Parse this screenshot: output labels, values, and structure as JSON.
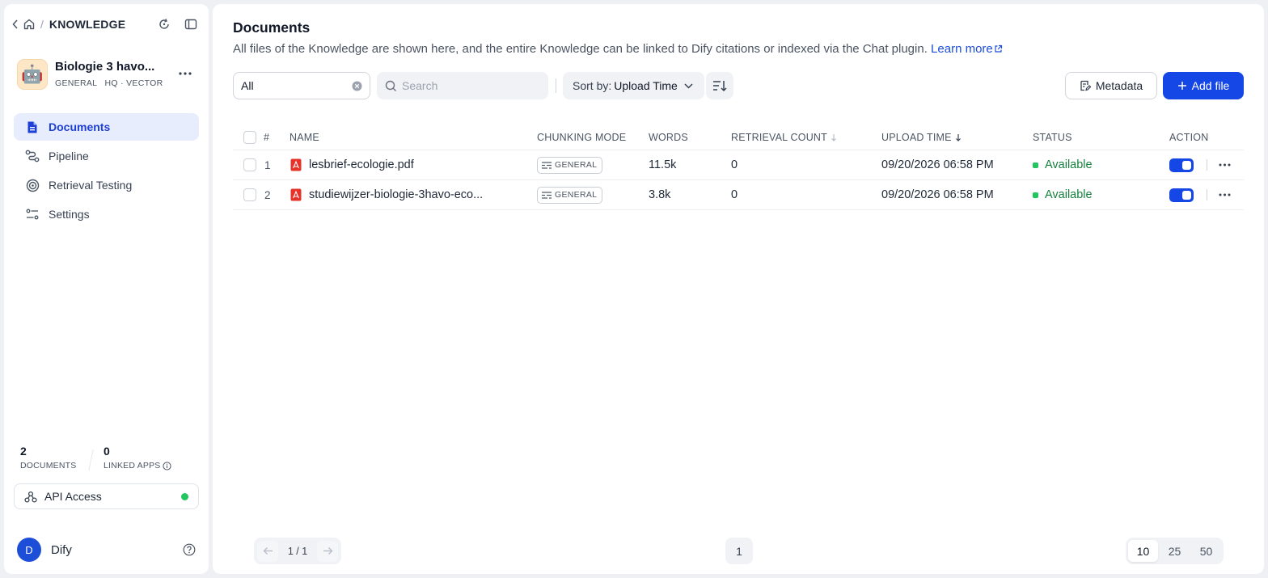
{
  "sidebar": {
    "breadcrumb": "KNOWLEDGE",
    "kb": {
      "name": "Biologie 3 havo...",
      "meta": "GENERAL   HQ · VECTOR",
      "avatar": "🤖"
    },
    "nav": [
      {
        "label": "Documents",
        "icon": "document-icon",
        "active": true
      },
      {
        "label": "Pipeline",
        "icon": "pipeline-icon",
        "active": false
      },
      {
        "label": "Retrieval Testing",
        "icon": "target-icon",
        "active": false
      },
      {
        "label": "Settings",
        "icon": "settings-sliders-icon",
        "active": false
      }
    ],
    "stats": {
      "documents_count": "2",
      "documents_label": "DOCUMENTS",
      "apps_count": "0",
      "apps_label": "LINKED APPS"
    },
    "api_access": "API Access",
    "user": {
      "initial": "D",
      "name": "Dify"
    }
  },
  "main": {
    "title": "Documents",
    "description": "All files of the Knowledge are shown here, and the entire Knowledge can be linked to Dify citations or indexed via the Chat plugin.",
    "learn_more": "Learn more",
    "filter_value": "All",
    "search_placeholder": "Search",
    "sort_label": "Sort by:",
    "sort_value": "Upload Time",
    "metadata_button": "Metadata",
    "add_file_button": "Add file",
    "columns": {
      "index": "#",
      "name": "NAME",
      "mode": "CHUNKING MODE",
      "words": "WORDS",
      "retrieval": "RETRIEVAL COUNT",
      "upload": "UPLOAD TIME",
      "status": "STATUS",
      "action": "ACTION"
    },
    "rows": [
      {
        "index": "1",
        "name": "lesbrief-ecologie.pdf",
        "mode": "GENERAL",
        "words": "11.5k",
        "retrieval": "0",
        "upload": "09/20/2026 06:58 PM",
        "status": "Available"
      },
      {
        "index": "2",
        "name": "studiewijzer-biologie-3havo-eco...",
        "mode": "GENERAL",
        "words": "3.8k",
        "retrieval": "0",
        "upload": "09/20/2026 06:58 PM",
        "status": "Available"
      }
    ],
    "pagination": {
      "page_info": "1 / 1",
      "current_page": "1",
      "sizes": [
        "10",
        "25",
        "50"
      ],
      "selected_size": "10"
    }
  },
  "colors": {
    "primary": "#1447e6",
    "available": "#22c55e",
    "active_nav_bg": "#e8edfd"
  }
}
